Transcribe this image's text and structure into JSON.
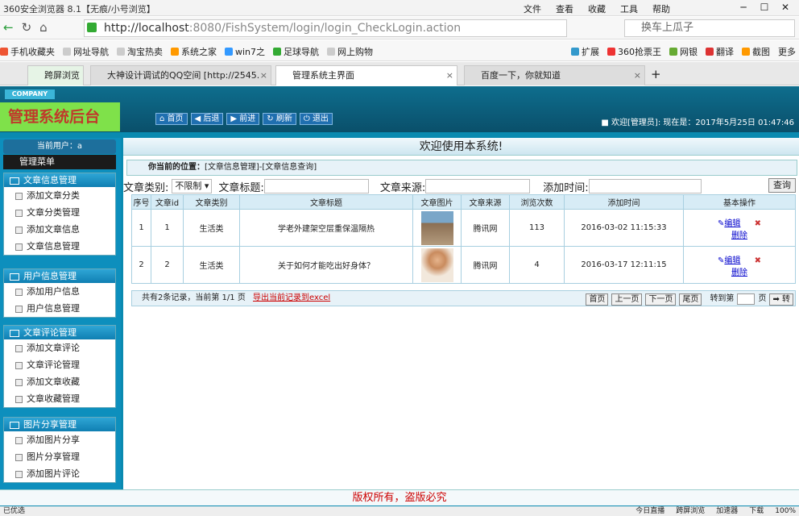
{
  "browser": {
    "title": "360安全浏览器 8.1【无痕/小号浏览】",
    "menus": [
      "文件",
      "查看",
      "收藏",
      "工具",
      "帮助"
    ],
    "url_host": "http://localhost",
    "url_path": ":8080/FishSystem/login/login_CheckLogin.action",
    "search_placeholder": "换车上瓜子",
    "favorites": [
      "手机收藏夹",
      "网址导航",
      "淘宝热卖",
      "系统之家",
      "win7之",
      "足球导航",
      "网上购物"
    ],
    "toolbar_right": [
      "扩展",
      "360抢票王",
      "网银",
      "翻译",
      "截图",
      "更多"
    ],
    "tabs": [
      "跨屏浏览",
      "大神设计调试的QQ空间 [http://2545.",
      "管理系统主界面",
      "百度一下，你就知道"
    ],
    "status_left": "已优选",
    "status_right": [
      "今日直播",
      "跨屏浏览",
      "加速器",
      "下载",
      "100%"
    ]
  },
  "app": {
    "company": "COMPANY",
    "title": "管理系统后台",
    "nav": [
      "首页",
      "后退",
      "前进",
      "刷新",
      "退出"
    ],
    "welcome": "欢迎[管理员]:  现在是：2017年5月25日 01:47:46",
    "current_user": "当前用户：a",
    "main_menu": "管理菜单",
    "banner": "欢迎使用本系统!",
    "footer": "版权所有，盗版必究"
  },
  "menu_groups": [
    {
      "title": "文章信息管理",
      "items": [
        "添加文章分类",
        "文章分类管理",
        "添加文章信息",
        "文章信息管理"
      ]
    },
    {
      "title": "用户信息管理",
      "items": [
        "添加用户信息",
        "用户信息管理"
      ]
    },
    {
      "title": "文章评论管理",
      "items": [
        "添加文章评论",
        "文章评论管理",
        "添加文章收藏",
        "文章收藏管理"
      ]
    },
    {
      "title": "图片分享管理",
      "items": [
        "添加图片分享",
        "图片分享管理",
        "添加图片评论"
      ]
    }
  ],
  "position": {
    "label": "你当前的位置：",
    "path": "[文章信息管理]-[文章信息查询]"
  },
  "search": {
    "category_label": "文章类别:",
    "category_value": "不限制",
    "title_label": "文章标题:",
    "source_label": "文章来源:",
    "time_label": "添加时间:",
    "query_button": "查询"
  },
  "table": {
    "headers": [
      "序号",
      "文章id",
      "文章类别",
      "文章标题",
      "文章图片",
      "文章来源",
      "浏览次数",
      "添加时间",
      "基本操作"
    ],
    "rows": [
      {
        "no": "1",
        "id": "1",
        "category": "生活类",
        "title": "学老外建架空层重保温隔热",
        "source": "腾讯网",
        "views": "113",
        "time": "2016-03-02 11:15:33",
        "edit": "编辑",
        "delete": "删除"
      },
      {
        "no": "2",
        "id": "2",
        "category": "生活类",
        "title": "关于如何才能吃出好身体？",
        "source": "腾讯网",
        "views": "4",
        "time": "2016-03-17 12:11:15",
        "edit": "编辑",
        "delete": "删除"
      }
    ]
  },
  "pager": {
    "summary": "共有2条记录，当前第 1/1 页",
    "export": "导出当前记录到excel",
    "buttons": [
      "首页",
      "上一页",
      "下一页",
      "尾页"
    ],
    "goto_label": "转到第",
    "page_label": "页",
    "go_button": "转"
  }
}
